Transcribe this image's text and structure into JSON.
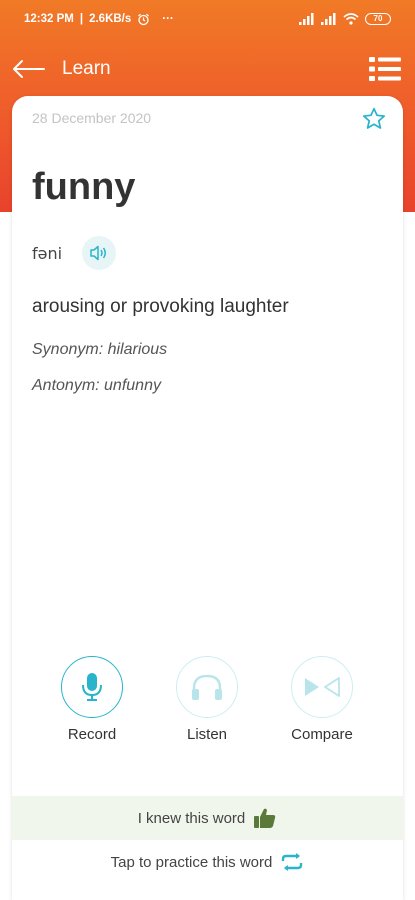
{
  "status_bar": {
    "time": "12:32 PM",
    "speed": "2.6KB/s",
    "more": "···",
    "battery": "70"
  },
  "app_bar": {
    "title": "Learn"
  },
  "card": {
    "date": "28 December 2020",
    "word": "funny",
    "phonetic": "fəni",
    "definition": "arousing or provoking laughter",
    "synonym": "Synonym: hilarious",
    "antonym": "Antonym: unfunny"
  },
  "actions": {
    "record": "Record",
    "listen": "Listen",
    "compare": "Compare"
  },
  "bottom": {
    "knew": "I knew this word",
    "practice": "Tap to practice this word"
  },
  "colors": {
    "header_top": "#f07a26",
    "header_bottom": "#e8432c",
    "accent": "#28b5cc",
    "thumb": "#5a7a3a"
  }
}
